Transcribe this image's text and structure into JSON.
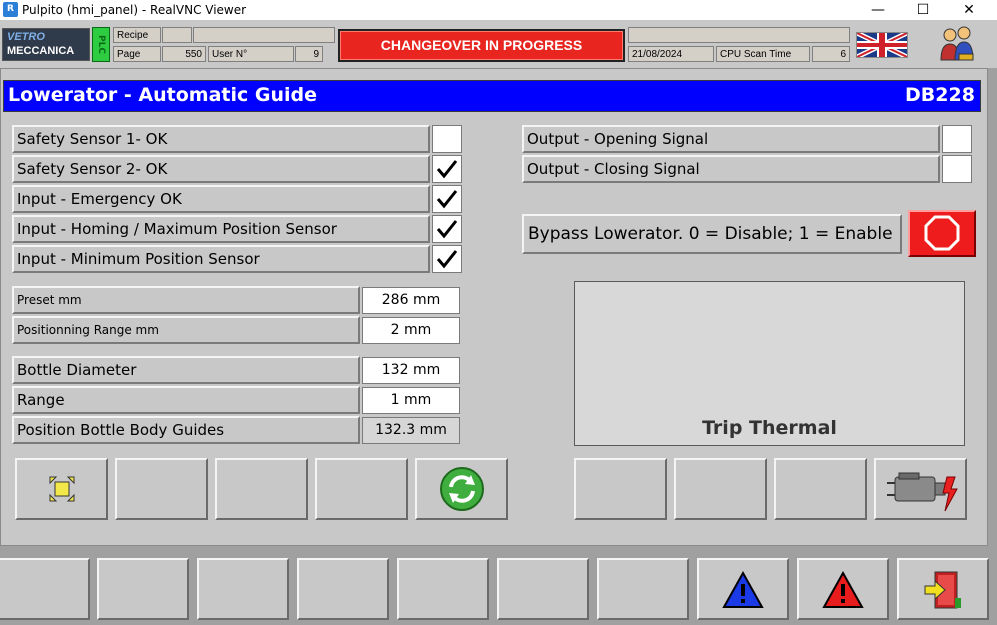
{
  "window": {
    "app_icon": "R",
    "title": "Pulpito (hmi_panel) - RealVNC Viewer",
    "minimize": "—",
    "maximize": "☐",
    "close": "✕"
  },
  "header": {
    "logo_line1": "VETRO",
    "logo_line2": "MECCANICA",
    "plc_label": "PLC",
    "recipe_label": "Recipe",
    "recipe_value": "",
    "page_label": "Page",
    "page_value": "550",
    "user_label": "User N°",
    "user_value": "9",
    "banner": "CHANGEOVER IN PROGRESS",
    "date": "21/08/2024",
    "scan_label": "CPU Scan Time",
    "scan_value": "6",
    "language_icon": "uk-flag-icon",
    "users_icon": "users-icon"
  },
  "panel": {
    "title": "Lowerator - Automatic Guide",
    "id": "DB228"
  },
  "status_rows": [
    {
      "label": "Safety Sensor 1- OK",
      "checked": false
    },
    {
      "label": "Safety Sensor 2- OK",
      "checked": true
    },
    {
      "label": "Input - Emergency OK",
      "checked": true
    },
    {
      "label": "Input - Homing / Maximum Position Sensor",
      "checked": true
    },
    {
      "label": "Input -  Minimum Position Sensor",
      "checked": true
    }
  ],
  "outputs": [
    {
      "label": "Output - Opening Signal",
      "checked": false
    },
    {
      "label": "Output - Closing Signal",
      "checked": false
    }
  ],
  "params_small": [
    {
      "label": "Preset mm",
      "value": "286 mm"
    },
    {
      "label": "Positionning Range mm",
      "value": "2 mm"
    }
  ],
  "params": [
    {
      "label": "Bottle Diameter",
      "value": "132 mm",
      "readonly": false
    },
    {
      "label": "Range",
      "value": "1 mm",
      "readonly": false
    },
    {
      "label": "Position Bottle Body Guides",
      "value": "132.3 mm",
      "readonly": true
    }
  ],
  "bypass": {
    "label": "Bypass Lowerator. 0 = Disable; 1 = Enable",
    "state_icon": "circle-icon",
    "color": "#ee1c1c"
  },
  "trip": {
    "label": "Trip Thermal"
  },
  "colors": {
    "title_bar": "#0000ff",
    "banner": "#e8251f",
    "panel": "#c8c8c8",
    "plc": "#2ecc40"
  }
}
